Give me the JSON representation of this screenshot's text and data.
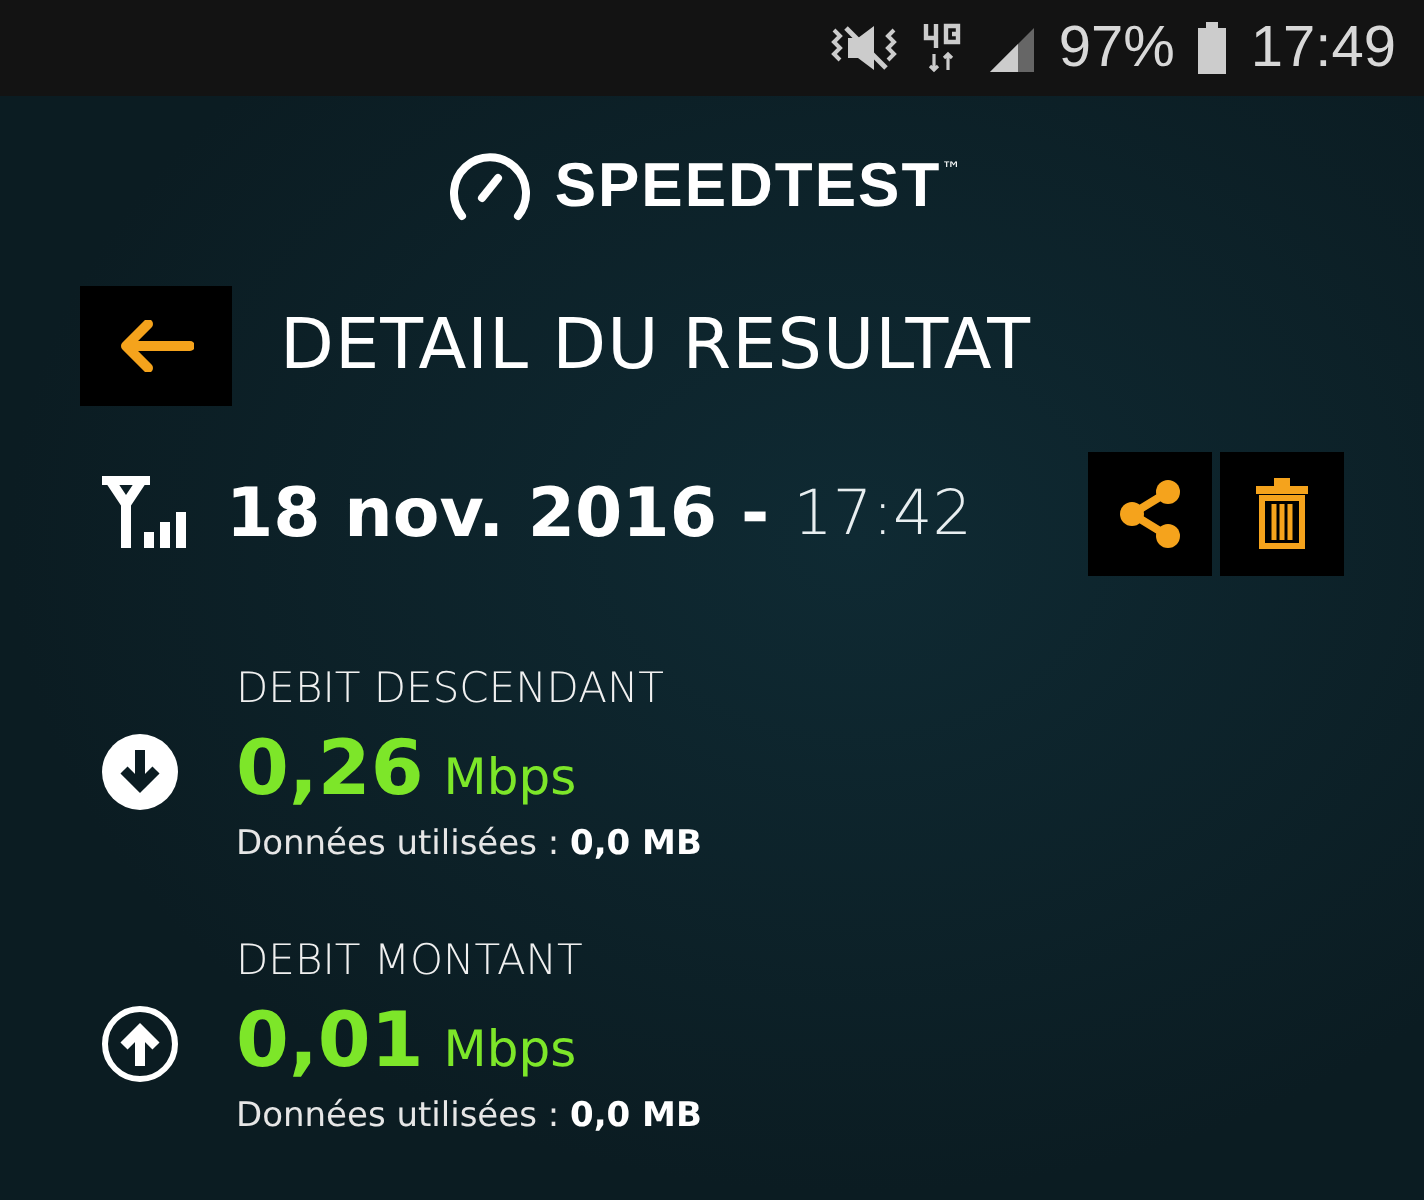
{
  "status_bar": {
    "battery": "97%",
    "time": "17:49"
  },
  "logo": {
    "name": "SPEEDTEST",
    "trademark": "™"
  },
  "header": {
    "title": "DETAIL DU RESULTAT"
  },
  "result": {
    "date": "18 nov. 2016",
    "separator": "-",
    "time": "17:42"
  },
  "metrics": [
    {
      "kind": "download",
      "label": "DEBIT DESCENDANT",
      "value": "0,26",
      "unit": "Mbps",
      "usage": "Données utilisées : **0,0 MB**"
    },
    {
      "kind": "upload",
      "label": "DEBIT MONTANT",
      "value": "0,01",
      "unit": "Mbps",
      "usage": "Données utilisées : **0,0 MB**"
    }
  ]
}
